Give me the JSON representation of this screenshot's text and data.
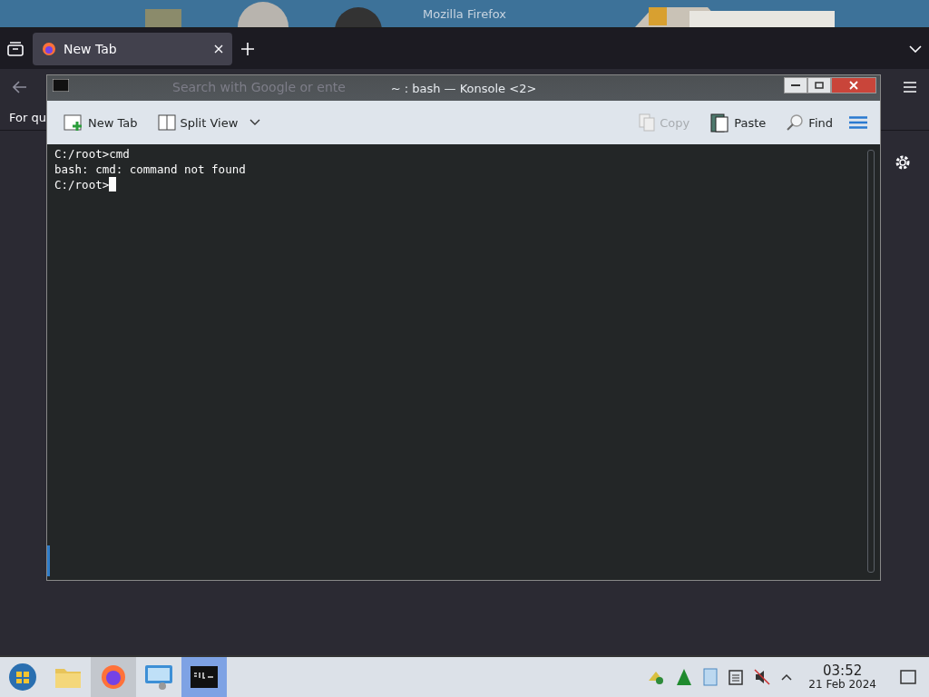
{
  "firefox": {
    "title": "Mozilla Firefox",
    "tabs": [
      {
        "label": "New Tab",
        "selected": true
      }
    ],
    "search": {
      "placeholder": "Search with Google or ente"
    },
    "bookmarks_text": "For qu"
  },
  "konsole": {
    "title": "~ : bash — Konsole <2>",
    "toolbar": [
      {
        "label": "New Tab",
        "kind": "new-tab",
        "disabled": false
      },
      {
        "label": "Split View",
        "kind": "split",
        "disabled": false
      },
      {
        "label": "Copy",
        "kind": "copy",
        "disabled": true
      },
      {
        "label": "Paste",
        "kind": "paste",
        "disabled": false
      },
      {
        "label": "Find",
        "kind": "find",
        "disabled": false
      }
    ],
    "terminal": {
      "lines": [
        "C:/root>cmd",
        "bash: cmd: command not found",
        "C:/root>"
      ],
      "cursor": true
    }
  },
  "taskbar": {
    "apps": [
      {
        "kind": "start",
        "selected": false,
        "running": false
      },
      {
        "kind": "files",
        "selected": false,
        "running": false
      },
      {
        "kind": "firefox",
        "selected": false,
        "running": true
      },
      {
        "kind": "settings",
        "selected": false,
        "running": false
      },
      {
        "kind": "terminal",
        "selected": true,
        "running": true
      }
    ],
    "clock": {
      "time": "03:52",
      "date": "21 Feb 2024"
    }
  }
}
